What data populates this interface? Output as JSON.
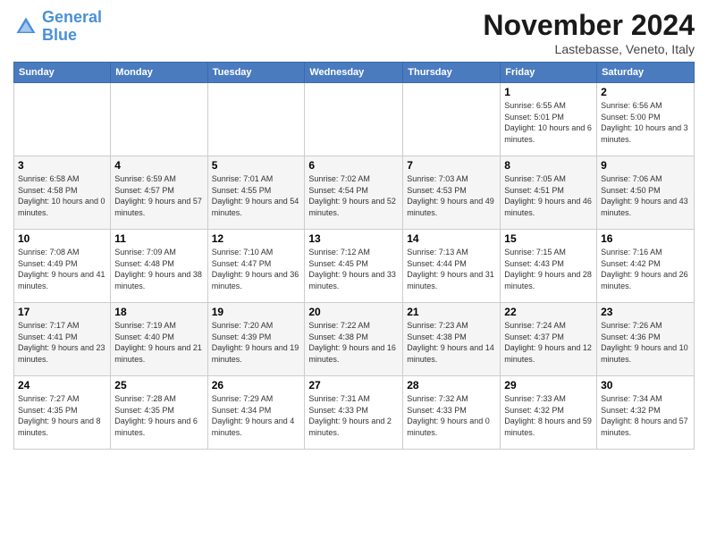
{
  "logo": {
    "text_general": "General",
    "text_blue": "Blue"
  },
  "header": {
    "month": "November 2024",
    "location": "Lastebasse, Veneto, Italy"
  },
  "weekdays": [
    "Sunday",
    "Monday",
    "Tuesday",
    "Wednesday",
    "Thursday",
    "Friday",
    "Saturday"
  ],
  "weeks": [
    [
      {
        "day": "",
        "info": ""
      },
      {
        "day": "",
        "info": ""
      },
      {
        "day": "",
        "info": ""
      },
      {
        "day": "",
        "info": ""
      },
      {
        "day": "",
        "info": ""
      },
      {
        "day": "1",
        "info": "Sunrise: 6:55 AM\nSunset: 5:01 PM\nDaylight: 10 hours and 6 minutes."
      },
      {
        "day": "2",
        "info": "Sunrise: 6:56 AM\nSunset: 5:00 PM\nDaylight: 10 hours and 3 minutes."
      }
    ],
    [
      {
        "day": "3",
        "info": "Sunrise: 6:58 AM\nSunset: 4:58 PM\nDaylight: 10 hours and 0 minutes."
      },
      {
        "day": "4",
        "info": "Sunrise: 6:59 AM\nSunset: 4:57 PM\nDaylight: 9 hours and 57 minutes."
      },
      {
        "day": "5",
        "info": "Sunrise: 7:01 AM\nSunset: 4:55 PM\nDaylight: 9 hours and 54 minutes."
      },
      {
        "day": "6",
        "info": "Sunrise: 7:02 AM\nSunset: 4:54 PM\nDaylight: 9 hours and 52 minutes."
      },
      {
        "day": "7",
        "info": "Sunrise: 7:03 AM\nSunset: 4:53 PM\nDaylight: 9 hours and 49 minutes."
      },
      {
        "day": "8",
        "info": "Sunrise: 7:05 AM\nSunset: 4:51 PM\nDaylight: 9 hours and 46 minutes."
      },
      {
        "day": "9",
        "info": "Sunrise: 7:06 AM\nSunset: 4:50 PM\nDaylight: 9 hours and 43 minutes."
      }
    ],
    [
      {
        "day": "10",
        "info": "Sunrise: 7:08 AM\nSunset: 4:49 PM\nDaylight: 9 hours and 41 minutes."
      },
      {
        "day": "11",
        "info": "Sunrise: 7:09 AM\nSunset: 4:48 PM\nDaylight: 9 hours and 38 minutes."
      },
      {
        "day": "12",
        "info": "Sunrise: 7:10 AM\nSunset: 4:47 PM\nDaylight: 9 hours and 36 minutes."
      },
      {
        "day": "13",
        "info": "Sunrise: 7:12 AM\nSunset: 4:45 PM\nDaylight: 9 hours and 33 minutes."
      },
      {
        "day": "14",
        "info": "Sunrise: 7:13 AM\nSunset: 4:44 PM\nDaylight: 9 hours and 31 minutes."
      },
      {
        "day": "15",
        "info": "Sunrise: 7:15 AM\nSunset: 4:43 PM\nDaylight: 9 hours and 28 minutes."
      },
      {
        "day": "16",
        "info": "Sunrise: 7:16 AM\nSunset: 4:42 PM\nDaylight: 9 hours and 26 minutes."
      }
    ],
    [
      {
        "day": "17",
        "info": "Sunrise: 7:17 AM\nSunset: 4:41 PM\nDaylight: 9 hours and 23 minutes."
      },
      {
        "day": "18",
        "info": "Sunrise: 7:19 AM\nSunset: 4:40 PM\nDaylight: 9 hours and 21 minutes."
      },
      {
        "day": "19",
        "info": "Sunrise: 7:20 AM\nSunset: 4:39 PM\nDaylight: 9 hours and 19 minutes."
      },
      {
        "day": "20",
        "info": "Sunrise: 7:22 AM\nSunset: 4:38 PM\nDaylight: 9 hours and 16 minutes."
      },
      {
        "day": "21",
        "info": "Sunrise: 7:23 AM\nSunset: 4:38 PM\nDaylight: 9 hours and 14 minutes."
      },
      {
        "day": "22",
        "info": "Sunrise: 7:24 AM\nSunset: 4:37 PM\nDaylight: 9 hours and 12 minutes."
      },
      {
        "day": "23",
        "info": "Sunrise: 7:26 AM\nSunset: 4:36 PM\nDaylight: 9 hours and 10 minutes."
      }
    ],
    [
      {
        "day": "24",
        "info": "Sunrise: 7:27 AM\nSunset: 4:35 PM\nDaylight: 9 hours and 8 minutes."
      },
      {
        "day": "25",
        "info": "Sunrise: 7:28 AM\nSunset: 4:35 PM\nDaylight: 9 hours and 6 minutes."
      },
      {
        "day": "26",
        "info": "Sunrise: 7:29 AM\nSunset: 4:34 PM\nDaylight: 9 hours and 4 minutes."
      },
      {
        "day": "27",
        "info": "Sunrise: 7:31 AM\nSunset: 4:33 PM\nDaylight: 9 hours and 2 minutes."
      },
      {
        "day": "28",
        "info": "Sunrise: 7:32 AM\nSunset: 4:33 PM\nDaylight: 9 hours and 0 minutes."
      },
      {
        "day": "29",
        "info": "Sunrise: 7:33 AM\nSunset: 4:32 PM\nDaylight: 8 hours and 59 minutes."
      },
      {
        "day": "30",
        "info": "Sunrise: 7:34 AM\nSunset: 4:32 PM\nDaylight: 8 hours and 57 minutes."
      }
    ]
  ]
}
